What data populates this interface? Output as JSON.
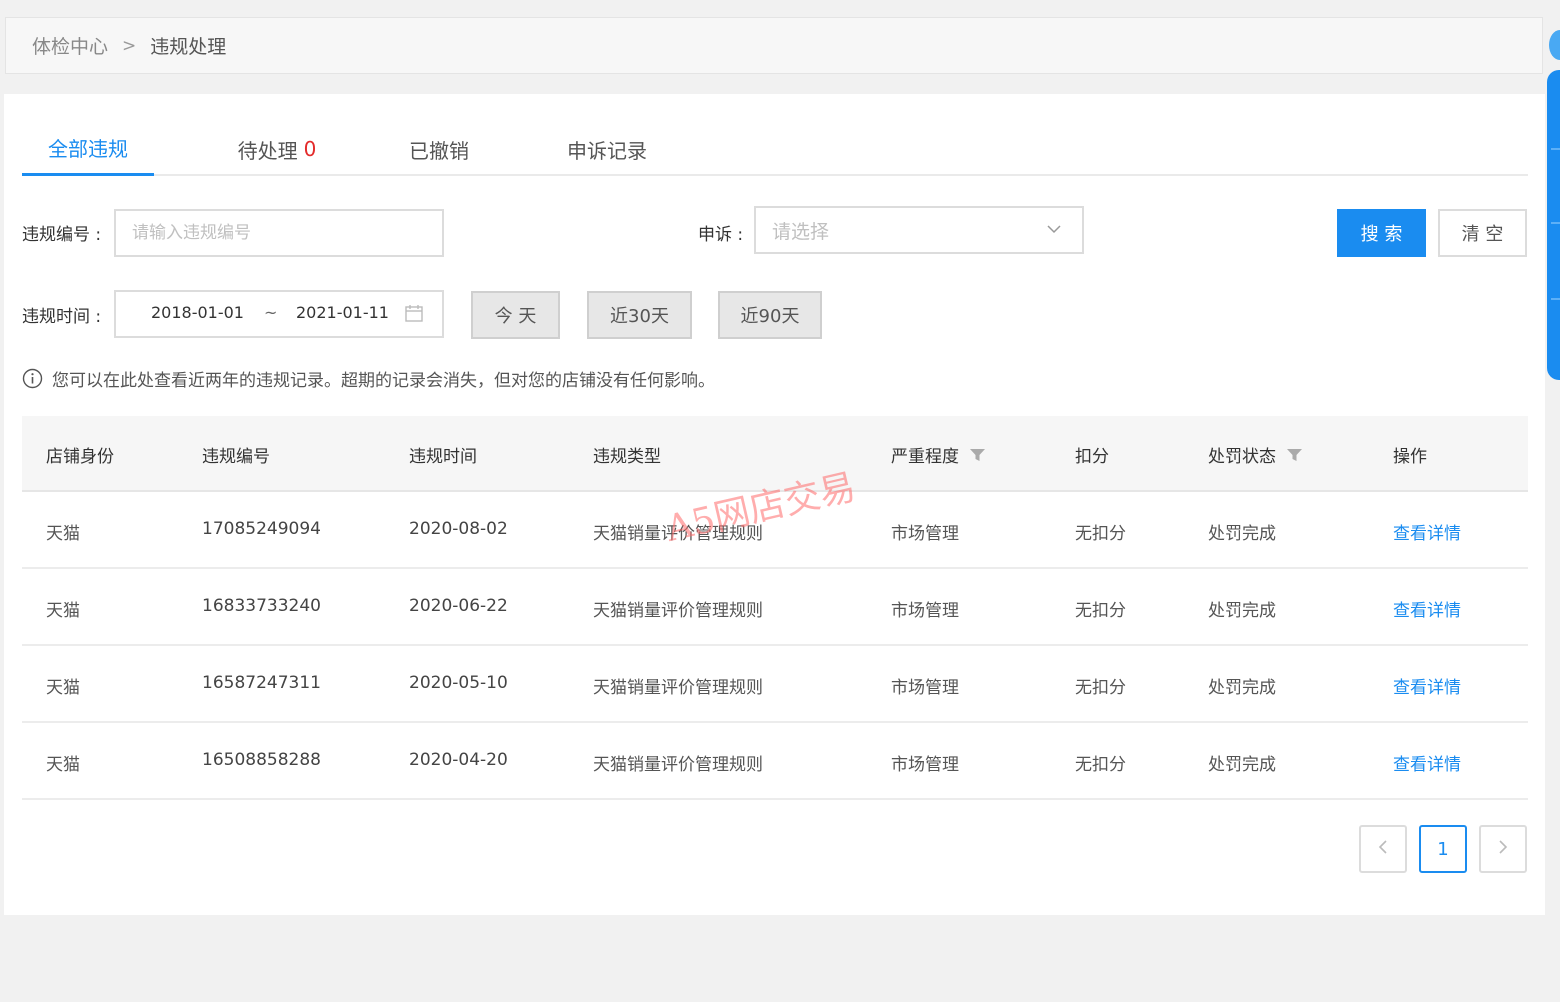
{
  "breadcrumb": {
    "root": "体检中心",
    "separator": ">",
    "current": "违规处理"
  },
  "tabs": [
    {
      "label": "全部违规"
    },
    {
      "label": "待处理",
      "count": "0"
    },
    {
      "label": "已撤销"
    },
    {
      "label": "申诉记录"
    }
  ],
  "filters": {
    "violation_no_label": "违规编号 :",
    "violation_no_placeholder": "请输入违规编号",
    "appeal_label": "申诉 :",
    "appeal_placeholder": "请选择",
    "search_button": "搜 索",
    "clear_button": "清 空",
    "time_label": "违规时间 :",
    "date_start": "2018-01-01",
    "date_sep": "~",
    "date_end": "2021-01-11",
    "quick_today": "今 天",
    "quick_30": "近30天",
    "quick_90": "近90天"
  },
  "notice": "您可以在此处查看近两年的违规记录。超期的记录会消失，但对您的店铺没有任何影响。",
  "table": {
    "headers": [
      "店铺身份",
      "违规编号",
      "违规时间",
      "违规类型",
      "严重程度",
      "扣分",
      "处罚状态",
      "操作"
    ],
    "rows": [
      [
        "天猫",
        "17085249094",
        "2020-08-02",
        "天猫销量评价管理规则",
        "市场管理",
        "无扣分",
        "处罚完成",
        "查看详情"
      ],
      [
        "天猫",
        "16833733240",
        "2020-06-22",
        "天猫销量评价管理规则",
        "市场管理",
        "无扣分",
        "处罚完成",
        "查看详情"
      ],
      [
        "天猫",
        "16587247311",
        "2020-05-10",
        "天猫销量评价管理规则",
        "市场管理",
        "无扣分",
        "处罚完成",
        "查看详情"
      ],
      [
        "天猫",
        "16508858288",
        "2020-04-20",
        "天猫销量评价管理规则",
        "市场管理",
        "无扣分",
        "处罚完成",
        "查看详情"
      ]
    ]
  },
  "pagination": {
    "current_page": "1"
  },
  "watermark": "A5网店交易",
  "colors": {
    "accent": "#1a8cf0",
    "count_red": "#e32b2b"
  }
}
